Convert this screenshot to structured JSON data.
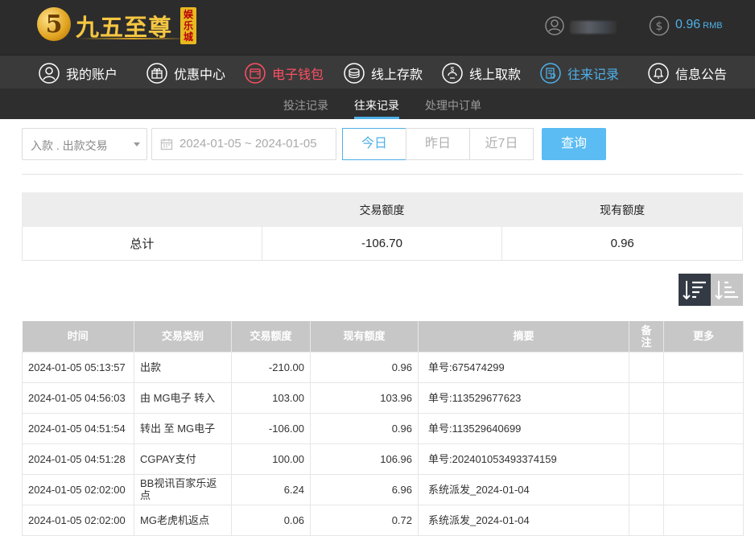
{
  "header": {
    "logo_text": "九五至尊",
    "logo_badge": "娱乐城",
    "logo_digit": "5",
    "balance_value": "0.96",
    "balance_unit": "RMB"
  },
  "nav": [
    {
      "label": "我的账户",
      "icon": "user-icon"
    },
    {
      "label": "优惠中心",
      "icon": "gift-icon"
    },
    {
      "label": "电子钱包",
      "icon": "wallet-icon"
    },
    {
      "label": "线上存款",
      "icon": "deposit-icon"
    },
    {
      "label": "线上取款",
      "icon": "withdraw-icon"
    },
    {
      "label": "往来记录",
      "icon": "records-icon"
    },
    {
      "label": "信息公告",
      "icon": "bell-icon"
    }
  ],
  "subnav": [
    "投注记录",
    "往来记录",
    "处理中订单"
  ],
  "filters": {
    "type_select": "入款 . 出款交易",
    "date_range": "2024-01-05 ~ 2024-01-05",
    "quick": [
      "今日",
      "昨日",
      "近7日"
    ],
    "query_label": "查询"
  },
  "summary": {
    "headers": [
      "交易额度",
      "现有额度"
    ],
    "row_label": "总计",
    "amount": "-106.70",
    "balance": "0.96"
  },
  "table": {
    "headers": [
      "时间",
      "交易类别",
      "交易额度",
      "现有额度",
      "摘要",
      "备注",
      "更多"
    ],
    "rows": [
      [
        "2024-01-05 05:13:57",
        "出款",
        "-210.00",
        "0.96",
        "单号:675474299"
      ],
      [
        "2024-01-05 04:56:03",
        "由 MG电子 转入",
        "103.00",
        "103.96",
        "单号:113529677623"
      ],
      [
        "2024-01-05 04:51:54",
        "转出 至 MG电子",
        "-106.00",
        "0.96",
        "单号:113529640699"
      ],
      [
        "2024-01-05 04:51:28",
        "CGPAY支付",
        "100.00",
        "106.96",
        "单号:202401053493374159"
      ],
      [
        "2024-01-05 02:02:00",
        "BB视讯百家乐返点",
        "6.24",
        "6.96",
        "系统派发_2024-01-04"
      ],
      [
        "2024-01-05 02:02:00",
        "MG老虎机返点",
        "0.06",
        "0.72",
        "系统派发_2024-01-04"
      ]
    ]
  },
  "colors": {
    "accent_blue": "#4fb0e8",
    "accent_red": "#ff5063",
    "topbar": "#2c2c2c",
    "navbar": "#3a3a3a"
  }
}
